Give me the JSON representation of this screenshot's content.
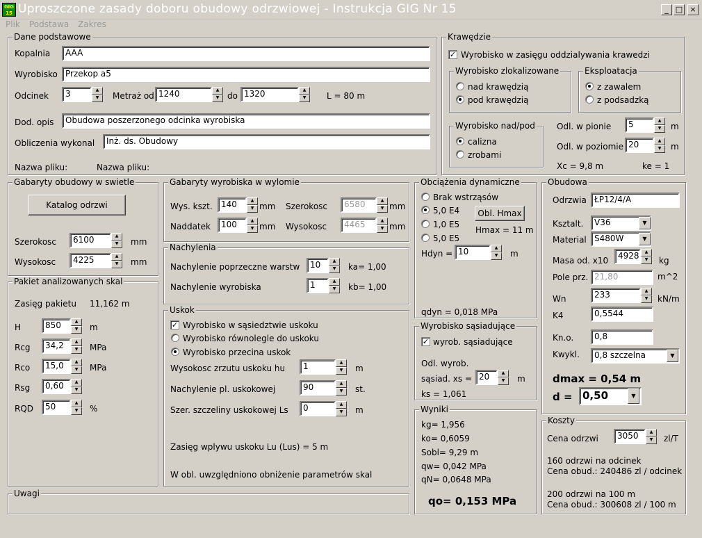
{
  "window": {
    "icon_text": "GIG 15",
    "title": "Uproszczone zasady doboru obudowy odrzwiowej - Instrukcja GIG Nr 15",
    "minimize": "_",
    "maximize": "□",
    "close": "×"
  },
  "menu": [
    "Plik",
    "Podstawa",
    "Zakres"
  ],
  "dane": {
    "legend": "Dane podstawowe",
    "kopalnia_label": "Kopalnia",
    "kopalnia": "AAA",
    "wyrobisko_label": "Wyrobisko",
    "wyrobisko": "Przekop a5",
    "odcinek_label": "Odcinek",
    "odcinek": "3",
    "metraz_label": "Metraż od",
    "metraz_od": "1240",
    "do_label": "do",
    "metraz_do": "1320",
    "length": "L = 80 m",
    "opis_label": "Dod. opis",
    "opis": "Obudowa poszerzonego odcinka wyrobiska",
    "oblicz_label": "Obliczenia wykonal",
    "oblicz": "Inż. ds. Obudowy",
    "plik1": "Nazwa pliku:",
    "plik2": "Nazwa pliku:"
  },
  "krawedzie": {
    "legend": "Krawędzie",
    "zasieg": "Wyrobisko w zasięgu oddzialywania krawedzi",
    "zlok_legend": "Wyrobisko zlokalizowane",
    "nad": "nad krawędzią",
    "pod": "pod krawędzią",
    "eksp_legend": "Eksploatacja",
    "zawalem": "z zawalem",
    "podsadzka": "z podsadzką",
    "nadpod_legend": "Wyrobisko nad/pod",
    "calizna": "calizna",
    "zrobami": "zrobami",
    "pion_label": "Odl. w pionie",
    "pion": "5",
    "pion_unit": "m",
    "poziom_label": "Odl. w poziomie",
    "poziom": "20",
    "poziom_unit": "m",
    "xc": "Xc = 9,8 m",
    "ke": "ke = 1"
  },
  "gabaryty_obud": {
    "legend": "Gabaryty obudowy w swietle",
    "katalog": "Katalog odrzwi",
    "szer_label": "Szerokosc",
    "szer": "6100",
    "szer_unit": "mm",
    "wys_label": "Wysokosc",
    "wys": "4225",
    "wys_unit": "mm"
  },
  "pakiet": {
    "legend": "Pakiet analizowanych skal",
    "zasieg": "Zasięg pakietu",
    "zasieg_val": "11,162 m",
    "h_label": "H",
    "h": "850",
    "h_unit": "m",
    "rcg_label": "Rcg",
    "rcg": "34,2",
    "rcg_unit": "MPa",
    "rco_label": "Rco",
    "rco": "15,0",
    "rco_unit": "MPa",
    "rsg_label": "Rsg",
    "rsg": "0,60",
    "rsg_unit": "",
    "rqd_label": "RQD",
    "rqd": "50",
    "rqd_unit": "%"
  },
  "gabaryty_wyl": {
    "legend": "Gabaryty wyrobiska w wylomie",
    "wys_label": "Wys. kszt.",
    "wys": "140",
    "mm1": "mm",
    "szer_label": "Szerokosc",
    "szer": "6580",
    "mm2": "mm",
    "nad_label": "Naddatek",
    "nad": "100",
    "mm3": "mm",
    "wysk_label": "Wysokosc",
    "wysk": "4465",
    "mm4": "mm"
  },
  "nachylenia": {
    "legend": "Nachylenia",
    "pop_label": "Nachylenie poprzeczne warstw",
    "pop": "10",
    "ka": "ka=  1,00",
    "wyr_label": "Nachylenie wyrobiska",
    "wyr": "1",
    "kb": "kb=  1,00"
  },
  "uskok": {
    "legend": "Uskok",
    "opt1": "Wyrobisko w sąsiedztwie uskoku",
    "opt2": "Wyrobisko równolegle do uskoku",
    "opt3": "Wyrobisko przecina uskok",
    "hu_label": "Wysokosc zrzutu uskoku    hu",
    "hu": "1",
    "hu_unit": "m",
    "nach_label": "Nachylenie pl. uskokowej",
    "nach": "90",
    "nach_unit": "st.",
    "ls_label": "Szer. szczeliny uskokowej   Ls",
    "ls": "0",
    "ls_unit": "m",
    "zasieg": "Zasięg wplywu uskoku Lu (Lus) =     5 m",
    "note": "W obl. uwzględniono obniżenie parametrów skal"
  },
  "dynamiczne": {
    "legend": "Obciążenia dynamiczne",
    "brak": "Brak wstrząsów",
    "e4": "5,0 E4",
    "e5a": "1,0 E5",
    "e5b": "5,0 E5",
    "hmax_btn": "Obl. Hmax",
    "hmax": "Hmax = 11 m",
    "hdyn_label": "Hdyn =",
    "hdyn": "10",
    "hdyn_unit": "m",
    "qdyn": "qdyn =  0,018 MPa"
  },
  "sasiednie": {
    "legend": "Wyrobisko sąsiadujące",
    "chk": "wyrob. sąsiadujące",
    "odl1": "Odl. wyrob.",
    "odl2": "sąsiad. xs =",
    "xs": "20",
    "xs_unit": "m",
    "ks": "ks = 1,061"
  },
  "wyniki": {
    "legend": "Wyniki",
    "kg": "kg=  1,956",
    "ko": "ko=  0,6059",
    "sobl": "Sobl= 9,29 m",
    "qw": "qw=  0,042 MPa",
    "qn": "qN=  0,0648 MPa",
    "qo": "qo=  0,153 MPa"
  },
  "obudowa": {
    "legend": "Obudowa",
    "odrzwia_label": "Odrzwia",
    "odrzwia": "ŁP12/4/A",
    "ksztalt_label": "Ksztalt.",
    "ksztalt": "V36",
    "material_label": "Material",
    "material": "S480W",
    "masa_label": "Masa od. x10",
    "masa": "4928",
    "masa_unit": "kg",
    "pole_label": "Pole prz.",
    "pole": "21,80",
    "pole_unit": "m^2",
    "wn_label": "Wn",
    "wn": "233",
    "wn_unit": "kN/m",
    "k4_label": "K4",
    "k4": "0,5544",
    "kno_label": "Kn.o.",
    "kno": "0,8",
    "kwykl_label": "Kwykl.",
    "kwykl": "0,8 szczelna",
    "dmax": "dmax  = 0,54 m",
    "d_label": "d  =",
    "d": "0,50"
  },
  "koszty": {
    "legend": "Koszty",
    "cena_label": "Cena odrzwi",
    "cena": "3050",
    "cena_unit": "zl/T",
    "l1": "160 odrzwi na odcinek",
    "l2": "Cena obud.: 240486 zl / odcinek",
    "l3": "200 odrzwi na 100 m",
    "l4": "Cena obud.: 300608 zl / 100 m"
  },
  "uwagi": {
    "legend": "Uwagi"
  }
}
